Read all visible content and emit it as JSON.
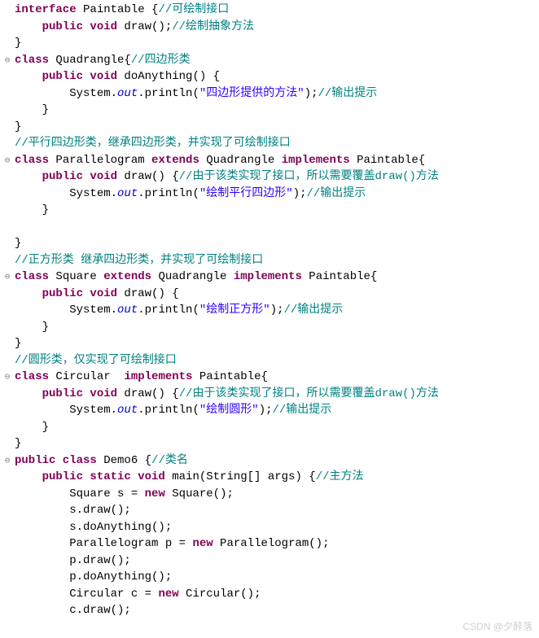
{
  "gutter": [
    "",
    "",
    "",
    "⊖",
    "",
    "",
    "",
    "",
    "",
    "⊖",
    "",
    "",
    "",
    "",
    "",
    "",
    "⊖",
    "",
    "",
    "",
    "",
    "",
    "⊖",
    "",
    "",
    "",
    "",
    "⊖",
    "",
    "",
    "",
    "",
    "",
    "",
    "",
    "",
    ""
  ],
  "tokens": [
    [
      [
        "kw",
        "interface"
      ],
      [
        "plain",
        " Paintable {"
      ],
      [
        "cm-cn",
        "//可绘制接口"
      ]
    ],
    [
      [
        "plain",
        "    "
      ],
      [
        "kw",
        "public void"
      ],
      [
        "plain",
        " draw();"
      ],
      [
        "cm-cn",
        "//绘制抽象方法"
      ]
    ],
    [
      [
        "plain",
        "}"
      ]
    ],
    [
      [
        "kw",
        "class"
      ],
      [
        "plain",
        " Quadrangle{"
      ],
      [
        "cm-cn",
        "//四边形类"
      ]
    ],
    [
      [
        "plain",
        "    "
      ],
      [
        "kw",
        "public void"
      ],
      [
        "plain",
        " doAnything() {"
      ]
    ],
    [
      [
        "plain",
        "        System."
      ],
      [
        "static-field",
        "out"
      ],
      [
        "plain",
        ".println("
      ],
      [
        "str",
        "\"四边形提供的方法\""
      ],
      [
        "plain",
        ");"
      ],
      [
        "cm-cn",
        "//输出提示"
      ]
    ],
    [
      [
        "plain",
        "    }"
      ]
    ],
    [
      [
        "plain",
        "}"
      ]
    ],
    [
      [
        "cm-cn",
        "//平行四边形类，继承四边形类，并实现了可绘制接口"
      ]
    ],
    [
      [
        "kw",
        "class"
      ],
      [
        "plain",
        " Parallelogram "
      ],
      [
        "kw",
        "extends"
      ],
      [
        "plain",
        " Quadrangle "
      ],
      [
        "kw",
        "implements"
      ],
      [
        "plain",
        " Paintable{"
      ]
    ],
    [
      [
        "plain",
        "    "
      ],
      [
        "kw",
        "public void"
      ],
      [
        "plain",
        " draw() {"
      ],
      [
        "cm-cn",
        "//由于该类实现了接口，所以需要覆盖draw()方法"
      ]
    ],
    [
      [
        "plain",
        "        System."
      ],
      [
        "static-field",
        "out"
      ],
      [
        "plain",
        ".println("
      ],
      [
        "str",
        "\"绘制平行四边形\""
      ],
      [
        "plain",
        ");"
      ],
      [
        "cm-cn",
        "//输出提示"
      ]
    ],
    [
      [
        "plain",
        "    }"
      ]
    ],
    [
      [
        "plain",
        ""
      ]
    ],
    [
      [
        "plain",
        "}"
      ]
    ],
    [
      [
        "cm-cn",
        "//正方形类 继承四边形类，并实现了可绘制接口"
      ]
    ],
    [
      [
        "kw",
        "class"
      ],
      [
        "plain",
        " Square "
      ],
      [
        "kw",
        "extends"
      ],
      [
        "plain",
        " Quadrangle "
      ],
      [
        "kw",
        "implements"
      ],
      [
        "plain",
        " Paintable{"
      ]
    ],
    [
      [
        "plain",
        "    "
      ],
      [
        "kw",
        "public void"
      ],
      [
        "plain",
        " draw() {"
      ]
    ],
    [
      [
        "plain",
        "        System."
      ],
      [
        "static-field",
        "out"
      ],
      [
        "plain",
        ".println("
      ],
      [
        "str",
        "\"绘制正方形\""
      ],
      [
        "plain",
        ");"
      ],
      [
        "cm-cn",
        "//输出提示"
      ]
    ],
    [
      [
        "plain",
        "    }"
      ]
    ],
    [
      [
        "plain",
        "}"
      ]
    ],
    [
      [
        "cm-cn",
        "//圆形类，仅实现了可绘制接口"
      ]
    ],
    [
      [
        "kw",
        "class"
      ],
      [
        "plain",
        " Circular  "
      ],
      [
        "kw",
        "implements"
      ],
      [
        "plain",
        " Paintable{"
      ]
    ],
    [
      [
        "plain",
        "    "
      ],
      [
        "kw",
        "public void"
      ],
      [
        "plain",
        " draw() {"
      ],
      [
        "cm-cn",
        "//由于该类实现了接口，所以需要覆盖draw()方法"
      ]
    ],
    [
      [
        "plain",
        "        System."
      ],
      [
        "static-field",
        "out"
      ],
      [
        "plain",
        ".println("
      ],
      [
        "str",
        "\"绘制圆形\""
      ],
      [
        "plain",
        ");"
      ],
      [
        "cm-cn",
        "//输出提示"
      ]
    ],
    [
      [
        "plain",
        "    }"
      ]
    ],
    [
      [
        "plain",
        "}"
      ]
    ],
    [
      [
        "kw",
        "public class"
      ],
      [
        "plain",
        " Demo6 {"
      ],
      [
        "cm-cn",
        "//类名"
      ]
    ],
    [
      [
        "plain",
        "    "
      ],
      [
        "kw",
        "public static void"
      ],
      [
        "plain",
        " main(String[] args) {"
      ],
      [
        "cm-cn",
        "//主方法"
      ]
    ],
    [
      [
        "plain",
        "        Square s = "
      ],
      [
        "kw",
        "new"
      ],
      [
        "plain",
        " Square();"
      ]
    ],
    [
      [
        "plain",
        "        s.draw();"
      ]
    ],
    [
      [
        "plain",
        "        s.doAnything();"
      ]
    ],
    [
      [
        "plain",
        "        Parallelogram p = "
      ],
      [
        "kw",
        "new"
      ],
      [
        "plain",
        " Parallelogram();"
      ]
    ],
    [
      [
        "plain",
        "        p.draw();"
      ]
    ],
    [
      [
        "plain",
        "        p.doAnything();"
      ]
    ],
    [
      [
        "plain",
        "        Circular c = "
      ],
      [
        "kw",
        "new"
      ],
      [
        "plain",
        " Circular();"
      ]
    ],
    [
      [
        "plain",
        "        c.draw();"
      ]
    ]
  ],
  "watermark": "CSDN @夕醉落"
}
